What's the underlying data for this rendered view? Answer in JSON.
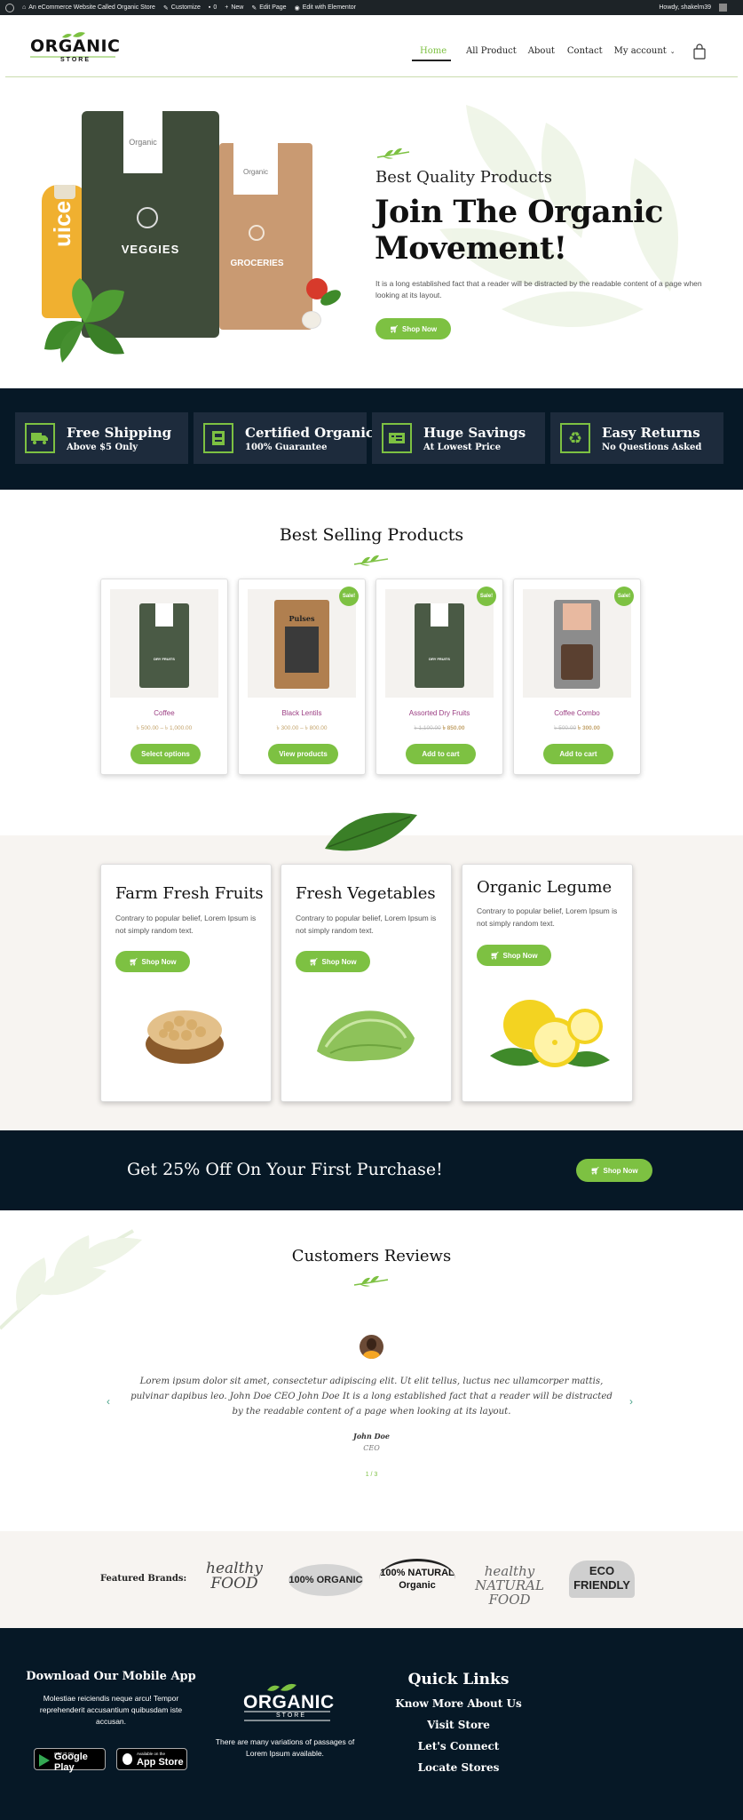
{
  "admin_bar": {
    "site_name": "An eCommerce Website Called Organic Store",
    "customize": "Customize",
    "comments": "0",
    "new": "New",
    "edit_page": "Edit Page",
    "elementor": "Edit with Elementor",
    "howdy": "Howdy, shakelm39"
  },
  "header": {
    "logo_main": "ORGANIC",
    "logo_sub": "STORE",
    "nav": [
      "Home",
      "All Product",
      "About",
      "Contact",
      "My account"
    ],
    "active_nav": "Home"
  },
  "hero": {
    "kicker": "Best Quality Products",
    "title_line1": "Join The Organic",
    "title_line2": "Movement!",
    "text": "It is a long established fact that a reader will be distracted by the readable content of a page when looking at its layout.",
    "button": "Shop Now",
    "bag1_brand": "Organic",
    "bag1_label": "VEGGIES",
    "bag2_brand": "Organic",
    "bag2_label": "GROCERIES",
    "bottle_label": "uice"
  },
  "features": [
    {
      "title": "Free Shipping",
      "subtitle": "Above $5 Only",
      "icon": "truck-icon"
    },
    {
      "title": "Certified Organic",
      "subtitle": "100% Guarantee",
      "icon": "certificate-icon"
    },
    {
      "title": "Huge Savings",
      "subtitle": "At Lowest Price",
      "icon": "money-icon"
    },
    {
      "title": "Easy Returns",
      "subtitle": "No Questions Asked",
      "icon": "recycle-icon"
    }
  ],
  "best_selling": {
    "title": "Best Selling Products",
    "products": [
      {
        "name": "Coffee",
        "price": "৳ 500.00 – ৳ 1,000.00",
        "old_price": "",
        "new_price": "",
        "sale": false,
        "button": "Select options",
        "pack_label": "DRY FRUITS",
        "pack_color": "#4a5a45"
      },
      {
        "name": "Black Lentils",
        "price": "৳ 300.00 – ৳ 800.00",
        "old_price": "",
        "new_price": "",
        "sale": true,
        "button": "View products",
        "pack_label": "Pulses",
        "pack_color": "#b07f4f"
      },
      {
        "name": "Assorted Dry Fruits",
        "price": "",
        "old_price": "৳ 1,100.00",
        "new_price": "৳ 850.00",
        "sale": true,
        "button": "Add to cart",
        "pack_label": "DRY FRUITS",
        "pack_color": "#4a5a45"
      },
      {
        "name": "Coffee Combo",
        "price": "",
        "old_price": "৳ 500.00",
        "new_price": "৳ 300.00",
        "sale": true,
        "button": "Add to cart",
        "pack_label": "",
        "pack_color": "#8c8c8c"
      }
    ],
    "sale_badge": "Sale!"
  },
  "categories": [
    {
      "title": "Farm Fresh Fruits",
      "text": "Contrary to popular belief, Lorem Ipsum is not simply random text.",
      "button": "Shop Now"
    },
    {
      "title": "Fresh Vegetables",
      "text": "Contrary to popular belief, Lorem Ipsum is not simply random text.",
      "button": "Shop Now"
    },
    {
      "title": "Organic Legume",
      "text": "Contrary to popular belief, Lorem Ipsum is not simply random text.",
      "button": "Shop Now"
    }
  ],
  "promo": {
    "text": "Get 25% Off On Your First Purchase!",
    "button": "Shop Now"
  },
  "reviews": {
    "title": "Customers Reviews",
    "quote": "Lorem ipsum dolor sit amet, consectetur adipiscing elit. Ut elit tellus, luctus nec ullamcorper mattis, pulvinar dapibus leo. John Doe CEO John Doe It is a long established fact that a reader will be distracted by the readable content of a page when looking at its layout.",
    "name": "John Doe",
    "role": "CEO",
    "pager": "1 / 3"
  },
  "brands": {
    "label": "Featured Brands:",
    "logos": [
      "healthy FOOD",
      "100% ORGANIC",
      "100% NATURAL Organic",
      "healthy NATURAL FOOD",
      "ECO FRIENDLY"
    ]
  },
  "footer": {
    "app_title": "Download Our Mobile App",
    "app_text": "Molestiae reiciendis neque arcu! Tempor reprehenderit accusantium quibusdam iste accusan.",
    "google_small": "GET IT ON",
    "google": "Google Play",
    "apple_small": "Available on the",
    "apple": "App Store",
    "logo_main": "ORGANIC",
    "logo_sub": "STORE",
    "logo_text": "There are many variations of passages of Lorem Ipsum available.",
    "links_title": "Quick Links",
    "links": [
      "Know More About Us",
      "Visit Store",
      "Let's Connect",
      "Locate Stores"
    ]
  },
  "colors": {
    "accent": "#7dc142",
    "dark": "#061826",
    "product_name": "#9b3d82",
    "price": "#c3a36b"
  }
}
